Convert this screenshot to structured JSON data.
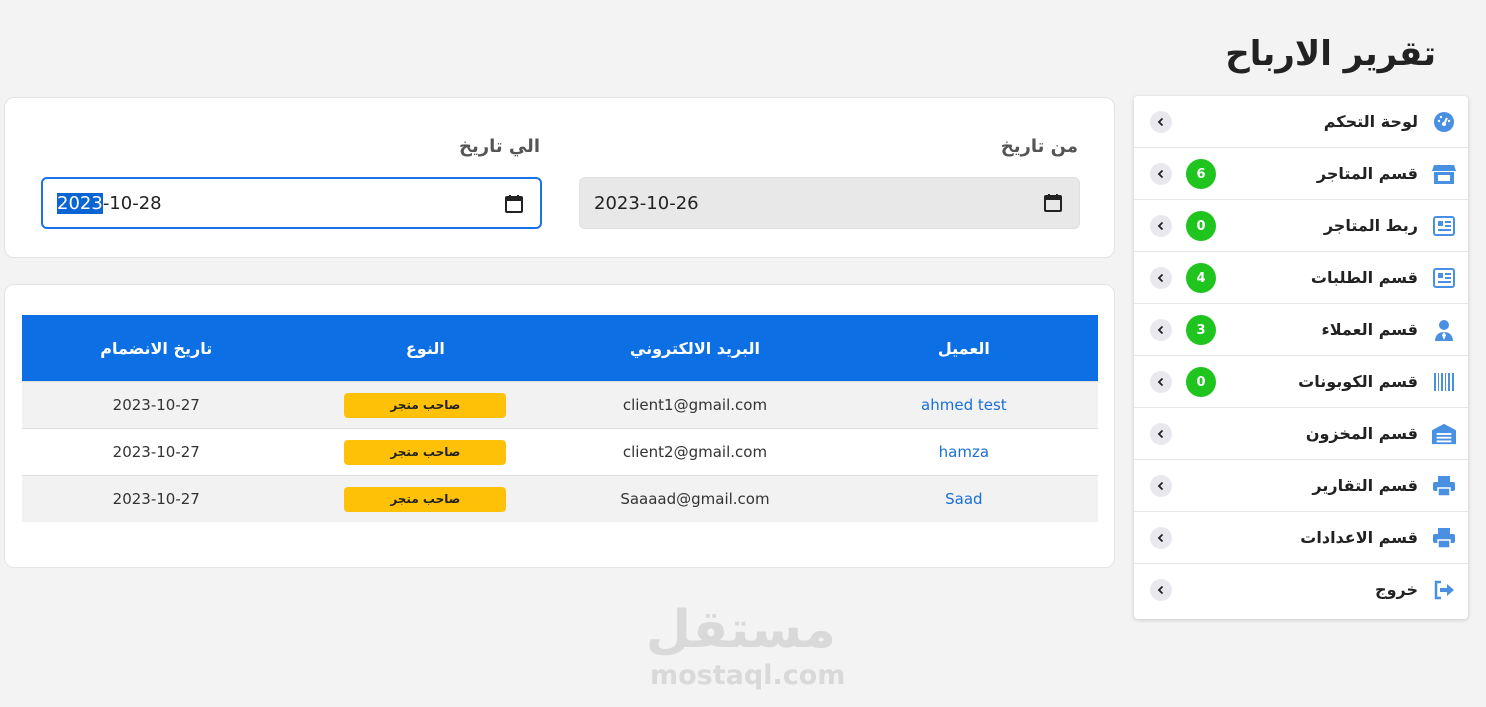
{
  "page": {
    "title": "تقرير الارباح"
  },
  "sidebar": {
    "items": [
      {
        "label": "لوحة التحكم",
        "icon": "dashboard-icon",
        "badge": null
      },
      {
        "label": "قسم المتاجر",
        "icon": "store-icon",
        "badge": "6"
      },
      {
        "label": "ربط المتاجر",
        "icon": "newspaper-icon",
        "badge": "0"
      },
      {
        "label": "قسم الطلبات",
        "icon": "newspaper-icon",
        "badge": "4"
      },
      {
        "label": "قسم العملاء",
        "icon": "user-tie-icon",
        "badge": "3"
      },
      {
        "label": "قسم الكوبونات",
        "icon": "barcode-icon",
        "badge": "0"
      },
      {
        "label": "قسم المخزون",
        "icon": "warehouse-icon",
        "badge": null
      },
      {
        "label": "قسم التقارير",
        "icon": "printer-icon",
        "badge": null
      },
      {
        "label": "قسم الاعدادات",
        "icon": "printer-icon",
        "badge": null
      },
      {
        "label": "خروج",
        "icon": "sign-out-icon",
        "badge": null
      }
    ],
    "accent_color": "#4a90e2",
    "badge_color": "#1fc41f"
  },
  "filter": {
    "from_label": "من تاريخ",
    "from_value": "2023-10-26",
    "to_label": "الي تاريخ",
    "to_value_selected": "2023",
    "to_value_rest": "-10-28"
  },
  "table": {
    "columns": [
      "العميل",
      "البريد الالكتروني",
      "النوع",
      "تاريخ الانضمام"
    ],
    "rows": [
      {
        "client": "ahmed test",
        "email": "client1@gmail.com",
        "type": "صاحب متجر",
        "joined": "2023-10-27"
      },
      {
        "client": "hamza",
        "email": "client2@gmail.com",
        "type": "صاحب متجر",
        "joined": "2023-10-27"
      },
      {
        "client": "Saad",
        "email": "Saaaad@gmail.com",
        "type": "صاحب متجر",
        "joined": "2023-10-27"
      }
    ],
    "header_color": "#0d6fe4",
    "badge_color": "#ffc107"
  },
  "watermark": {
    "arabic": "مستقل",
    "latin": "mostaql.com"
  }
}
